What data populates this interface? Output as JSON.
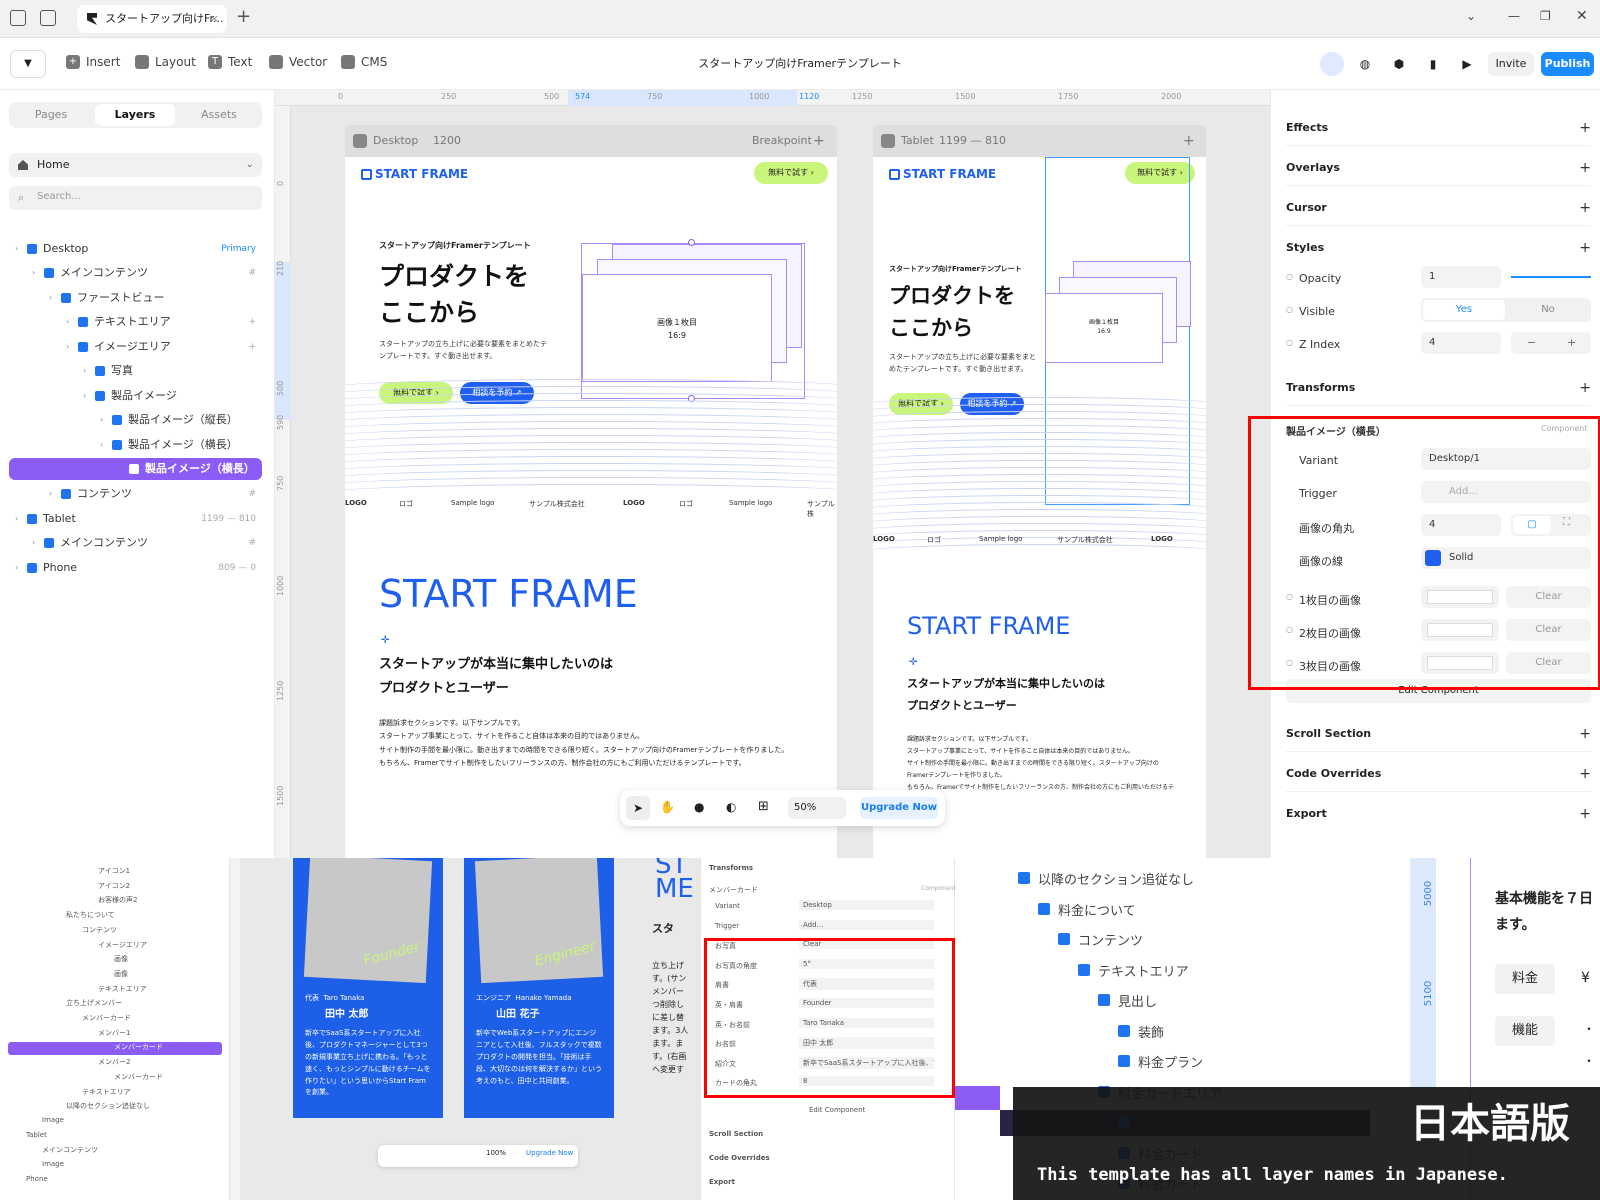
{
  "browser": {
    "tab_title": "スタートアップ向けFr...",
    "tab_close": "×",
    "new_tab": "+"
  },
  "toolbar": {
    "items": [
      "Insert",
      "Layout",
      "Text",
      "Vector",
      "CMS"
    ],
    "doc_title": "スタートアップ向けFramerテンプレート",
    "invite": "Invite",
    "publish": "Publish"
  },
  "left_panel": {
    "tabs": [
      "Pages",
      "Layers",
      "Assets"
    ],
    "active_tab": "Layers",
    "page": "Home",
    "search_placeholder": "Search...",
    "layers": [
      {
        "label": "Desktop",
        "meta": "Primary",
        "depth": 0
      },
      {
        "label": "メインコンテンツ",
        "meta": "#",
        "depth": 1
      },
      {
        "label": "ファーストビュー",
        "meta": "",
        "depth": 2
      },
      {
        "label": "テキストエリア",
        "meta": "+",
        "depth": 3
      },
      {
        "label": "イメージエリア",
        "meta": "+",
        "depth": 3
      },
      {
        "label": "写真",
        "meta": "",
        "depth": 4
      },
      {
        "label": "製品イメージ",
        "meta": "",
        "depth": 4
      },
      {
        "label": "製品イメージ（縦長）",
        "meta": "",
        "depth": 5
      },
      {
        "label": "製品イメージ（横長）",
        "meta": "",
        "depth": 5
      },
      {
        "label": "製品イメージ（横長）",
        "meta": "",
        "depth": 6,
        "selected": true
      },
      {
        "label": "コンテンツ",
        "meta": "#",
        "depth": 2
      },
      {
        "label": "Tablet",
        "meta": "1199 — 810",
        "depth": 0
      },
      {
        "label": "メインコンテンツ",
        "meta": "#",
        "depth": 1
      },
      {
        "label": "Phone",
        "meta": "809 — 0",
        "depth": 0
      }
    ]
  },
  "canvas": {
    "ruler_top": [
      "0",
      "250",
      "500",
      "574",
      "750",
      "1000",
      "1120",
      "1250",
      "1500",
      "1750",
      "2000"
    ],
    "ruler_left": [
      "0",
      "210",
      "500",
      "590",
      "750",
      "1000",
      "1250",
      "1500"
    ],
    "desktop_frame": {
      "name": "Desktop",
      "width": "1200",
      "breakpoint": "Breakpoint"
    },
    "tablet_frame": {
      "name": "Tablet",
      "range": "1199 — 810"
    },
    "site": {
      "logo": "START FRAME",
      "cta": "無料で試す ›",
      "eyebrow": "スタートアップ向けFramerテンプレート",
      "headline1": "プロダクトを",
      "headline2": "ここから",
      "body": "スタートアップの立ち上げに必要な要素をまとめたテンプレートです。すぐ動き出せます。",
      "btn_primary": "無料で試す ›",
      "btn_secondary": "相談を予約 ↗",
      "image_label": "画像１枚目",
      "image_ratio": "16:9",
      "logos": [
        "LOGO",
        "ロゴ",
        "Sample logo",
        "サンプル株式会社",
        "LOGO",
        "ロゴ",
        "Sample logo",
        "サンプル株"
      ],
      "big_title": "START FRAME",
      "sub1": "スタートアップが本当に集中したいのは",
      "sub2": "プロダクトとユーザー",
      "para": [
        "課題訴求セクションです。以下サンプルです。",
        "スタートアップ事業にとって、サイトを作ること自体は本来の目的ではありません。",
        "サイト制作の手間を最小限に。動き出すまでの時間をできる限り短く。スタートアップ向けのFramerテンプレートを作りました。",
        "もちろん、Framerでサイト制作をしたいフリーランスの方、制作会社の方にもご利用いただけるテンプレートです。"
      ],
      "tablet_para": [
        "課題訴求セクションです。以下サンプルです。",
        "スタートアップ事業にとって、サイトを作ること自体は本来の目的ではありません。",
        "サイト制作の手間を最小限に。動き出すまでの時間をできる限り短く。スタートアップ向けの",
        "Framerテンプレートを作りました。",
        "もちろん、Framerでサイト制作をしたいフリーランスの方、制作会社の方にもご利用いただけるテ"
      ]
    },
    "bottom_bar": {
      "zoom": "50%",
      "upgrade": "Upgrade Now"
    }
  },
  "right_panel": {
    "sections_top": [
      "Effects",
      "Overlays",
      "Cursor",
      "Styles"
    ],
    "opacity_label": "Opacity",
    "opacity_value": "1",
    "visible_label": "Visible",
    "visible_yes": "Yes",
    "visible_no": "No",
    "zindex_label": "Z Index",
    "zindex_value": "4",
    "transforms": "Transforms",
    "component_name": "製品イメージ（横長）",
    "component_tag": "Component",
    "variant_label": "Variant",
    "variant_value": "Desktop/1",
    "trigger_label": "Trigger",
    "trigger_value": "Add...",
    "radius_label": "画像の角丸",
    "radius_value": "4",
    "line_label": "画像の線",
    "line_value": "Solid",
    "images": [
      {
        "label": "1枚目の画像",
        "clear": "Clear"
      },
      {
        "label": "2枚目の画像",
        "clear": "Clear"
      },
      {
        "label": "3枚目の画像",
        "clear": "Clear"
      }
    ],
    "edit_component": "Edit Component",
    "sections_bottom": [
      "Scroll Section",
      "Code Overrides",
      "Export"
    ]
  },
  "bottom": {
    "left_layers": [
      "アイコン1",
      "アイコン2",
      "お客様の声2",
      "私たちについて",
      "コンテンツ",
      "イメージエリア",
      "画像",
      "画像",
      "テキストエリア",
      "立ち上げメンバー",
      "メンバーカード",
      "メンバー1",
      "メンバーカード",
      "メンバー2",
      "メンバーカード",
      "テキストエリア",
      "以降のセクション追従なし",
      "Image",
      "Tablet",
      "メインコンテンツ",
      "Image",
      "Phone"
    ],
    "card1": {
      "script": "Founder",
      "role": "代表",
      "en_name": "Taro Tanaka",
      "name": "田中 太郎",
      "bio": "新卒でSaaS系スタートアップに入社後、プロダクトマネージャーとして3つの新規事業立ち上げに携わる。「もっと速く、もっとシンプルに動けるチームを作りたい」という思いからStart Framを創業。"
    },
    "card2": {
      "script": "Engineer",
      "role": "エンジニア",
      "en_name": "Hanako Yamada",
      "name": "山田 花子",
      "bio": "新卒でWeb系スタートアップにエンジニアとして入社後、フルスタックで複数プロダクトの開発を担当。「技術は手段、大切なのは何を解決するか」という考えのもと、田中と共同創業。"
    },
    "mini_props": {
      "transforms": "Transforms",
      "component": "メンバーカード",
      "tag": "Component",
      "rows": [
        {
          "label": "Variant",
          "value": "Desktop"
        },
        {
          "label": "Trigger",
          "value": "Add..."
        },
        {
          "label": "お写真",
          "value": "Clear"
        },
        {
          "label": "お写真の角度",
          "value": "5°"
        },
        {
          "label": "肩書",
          "value": "代表"
        },
        {
          "label": "英・肩書",
          "value": "Founder"
        },
        {
          "label": "英・お名前",
          "value": "Taro Tanaka"
        },
        {
          "label": "お名前",
          "value": "田中 太郎"
        },
        {
          "label": "紹介文",
          "value": "新卒でSaaS系スタートアップに入社後、プロダクトマ..."
        },
        {
          "label": "カードの角丸",
          "value": "8"
        }
      ],
      "edit": "Edit Component",
      "bottom": [
        "Scroll Section",
        "Code Overrides",
        "Export"
      ]
    },
    "mini_zoom": "100%",
    "mini_upgrade": "Upgrade Now",
    "big_layers": [
      "以降のセクション追従なし",
      "料金について",
      "コンテンツ",
      "テキストエリア",
      "見出し",
      "装飾",
      "料金プラン",
      "料金カードエリア",
      "料金カード",
      "料金カード",
      "料金カード"
    ],
    "ruler": [
      "5000",
      "5100"
    ],
    "page_text": "基本機能を７日",
    "page_text2": "ます。",
    "price_label": "料金",
    "price_val": "¥",
    "feature_label": "機能",
    "text_frag": [
      "ST",
      "ME",
      "スタ",
      "立ち上げ",
      "す。(サン",
      "メンバー",
      "つ削除し",
      "に差し替",
      "ます。3人",
      "ます。ま",
      "す。(右画",
      "へ変更す"
    ],
    "badge_title": "日本語版",
    "badge_sub": "This template has all layer names in Japanese."
  },
  "colors": {
    "accent": "#1f5ff0",
    "publish": "#1a8cff",
    "selected_layer": "#8b5cf6",
    "lime": "#c8f57a",
    "highlight": "#ff0000"
  }
}
